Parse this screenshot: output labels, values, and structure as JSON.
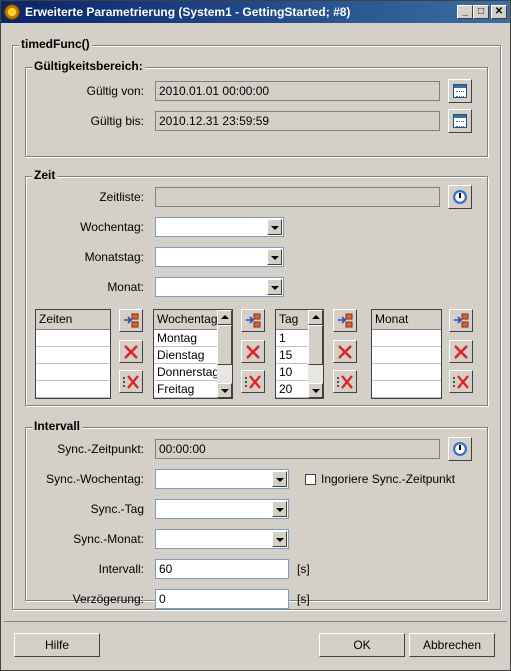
{
  "window": {
    "title": "Erweiterte Parametrierung (System1 - GettingStarted; #8)",
    "controls": [
      "_",
      "□",
      "✕"
    ]
  },
  "main_group": {
    "title": "timedFunc()"
  },
  "validity": {
    "title": "Gültigkeitsbereich:",
    "from_label": "Gültig von:",
    "from_value": "2010.01.01 00:00:00",
    "to_label": "Gültig bis:",
    "to_value": "2010.12.31 23:59:59"
  },
  "zeit": {
    "title": "Zeit",
    "zeitliste_label": "Zeitliste:",
    "zeitliste_value": "",
    "wochentag_label": "Wochentag:",
    "monatstag_label": "Monatstag:",
    "monat_label": "Monat:",
    "lists": {
      "zeiten": {
        "header": "Zeiten",
        "rows": [
          "",
          "",
          "",
          ""
        ]
      },
      "wochentag": {
        "header": "Wochentag",
        "rows": [
          "Montag",
          "Dienstag",
          "Donnerstag",
          "Freitag"
        ]
      },
      "tag": {
        "header": "Tag",
        "rows": [
          "1",
          "15",
          "10",
          "20"
        ]
      },
      "monat": {
        "header": "Monat",
        "rows": [
          "",
          "",
          "",
          ""
        ]
      }
    }
  },
  "intervall": {
    "title": "Intervall",
    "sync_zeitpunkt_label": "Sync.-Zeitpunkt:",
    "sync_zeitpunkt_value": "00:00:00",
    "sync_wochentag_label": "Sync.-Wochentag:",
    "ignore_label": "Ingoriere Sync.-Zeitpunkt",
    "sync_tag_label": "Sync.-Tag",
    "sync_monat_label": "Sync.-Monat:",
    "intervall_label": "Intervall:",
    "intervall_value": "60",
    "intervall_unit": "[s]",
    "verz_label": "Verzögerung:",
    "verz_value": "0",
    "verz_unit": "[s]"
  },
  "buttons": {
    "help": "Hilfe",
    "ok": "OK",
    "cancel": "Abbrechen"
  }
}
